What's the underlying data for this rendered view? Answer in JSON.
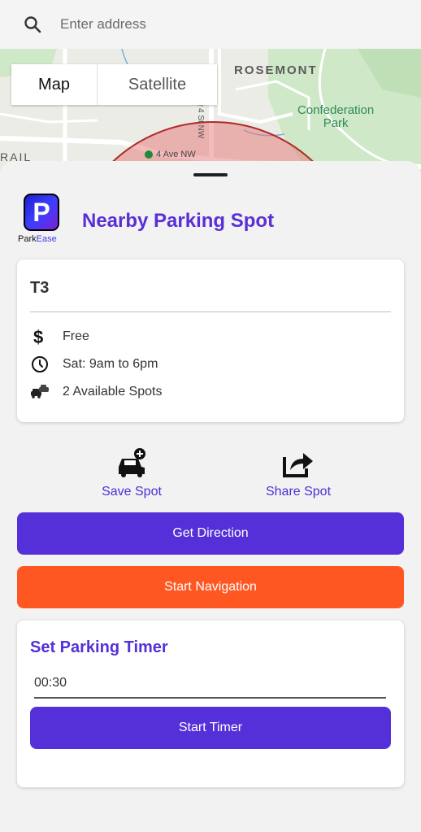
{
  "search": {
    "placeholder": "Enter address"
  },
  "map": {
    "toggle": {
      "map_label": "Map",
      "satellite_label": "Satellite"
    },
    "labels": {
      "rosemont": "ROSEMONT",
      "confederation_park": "Confederation\nPark",
      "street": "4 Ave NW",
      "rail": "RAIL",
      "sw": "4 St NW"
    }
  },
  "brand": {
    "name_part1": "Park",
    "name_part2": "Ease",
    "logo_letter": "P"
  },
  "sheet": {
    "title": "Nearby Parking Spot"
  },
  "spot": {
    "name": "T3",
    "price": "Free",
    "hours": "Sat: 9am to 6pm",
    "availability": "2 Available Spots"
  },
  "actions": {
    "save_label": "Save Spot",
    "share_label": "Share Spot"
  },
  "buttons": {
    "direction_label": "Get Direction",
    "navigation_label": "Start Navigation"
  },
  "timer": {
    "heading": "Set Parking Timer",
    "value": "00:30",
    "button_label": "Start Timer"
  },
  "colors": {
    "primary": "#5530d8",
    "accent": "#ff5722",
    "park_green": "#2e8b57"
  }
}
